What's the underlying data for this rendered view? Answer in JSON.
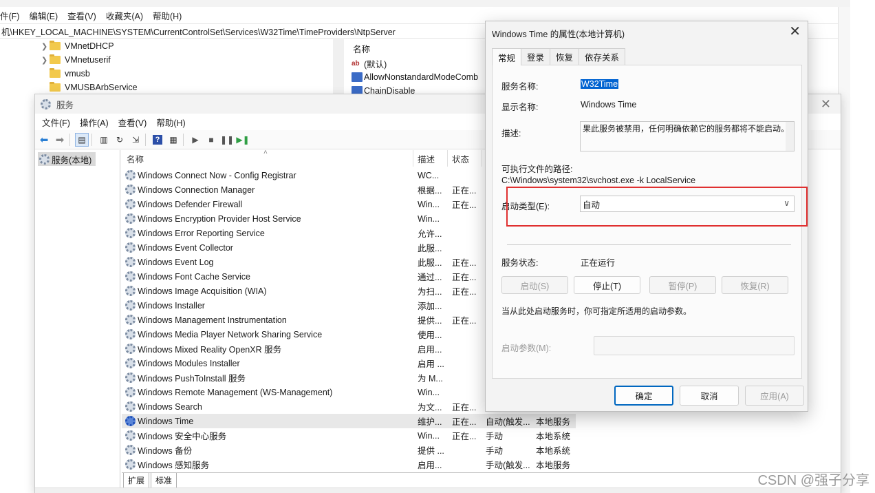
{
  "regedit": {
    "menu": [
      "件(F)",
      "编辑(E)",
      "查看(V)",
      "收藏夹(A)",
      "帮助(H)"
    ],
    "address": "机\\HKEY_LOCAL_MACHINE\\SYSTEM\\CurrentControlSet\\Services\\W32Time\\TimeProviders\\NtpServer",
    "tree": [
      "VMnetDHCP",
      "VMnetuserif",
      "vmusb",
      "VMUSBArbService"
    ],
    "values_header": "名称",
    "values": [
      "(默认)",
      "AllowNonstandardModeComb",
      "ChainDisable"
    ]
  },
  "services": {
    "title": "服务",
    "menu": [
      "文件(F)",
      "操作(A)",
      "查看(V)",
      "帮助(H)"
    ],
    "left_item": "服务(本地)",
    "columns": {
      "name": "名称",
      "desc": "描述",
      "status": "状态"
    },
    "rows": [
      {
        "name": "Windows Connect Now - Config Registrar",
        "desc": "WC...",
        "status": "",
        "start": "",
        "logon": ""
      },
      {
        "name": "Windows Connection Manager",
        "desc": "根据...",
        "status": "正在...",
        "start": "",
        "logon": ""
      },
      {
        "name": "Windows Defender Firewall",
        "desc": "Win...",
        "status": "正在...",
        "start": "",
        "logon": ""
      },
      {
        "name": "Windows Encryption Provider Host Service",
        "desc": "Win...",
        "status": "",
        "start": "",
        "logon": ""
      },
      {
        "name": "Windows Error Reporting Service",
        "desc": "允许...",
        "status": "",
        "start": "",
        "logon": ""
      },
      {
        "name": "Windows Event Collector",
        "desc": "此服...",
        "status": "",
        "start": "",
        "logon": ""
      },
      {
        "name": "Windows Event Log",
        "desc": "此服...",
        "status": "正在...",
        "start": "",
        "logon": ""
      },
      {
        "name": "Windows Font Cache Service",
        "desc": "通过...",
        "status": "正在...",
        "start": "",
        "logon": ""
      },
      {
        "name": "Windows Image Acquisition (WIA)",
        "desc": "为扫...",
        "status": "正在...",
        "start": "",
        "logon": ""
      },
      {
        "name": "Windows Installer",
        "desc": "添加...",
        "status": "",
        "start": "",
        "logon": ""
      },
      {
        "name": "Windows Management Instrumentation",
        "desc": "提供...",
        "status": "正在...",
        "start": "",
        "logon": ""
      },
      {
        "name": "Windows Media Player Network Sharing Service",
        "desc": "使用...",
        "status": "",
        "start": "",
        "logon": ""
      },
      {
        "name": "Windows Mixed Reality OpenXR 服务",
        "desc": "启用...",
        "status": "",
        "start": "",
        "logon": ""
      },
      {
        "name": "Windows Modules Installer",
        "desc": "启用 ...",
        "status": "",
        "start": "",
        "logon": ""
      },
      {
        "name": "Windows PushToInstall 服务",
        "desc": "为 M...",
        "status": "",
        "start": "",
        "logon": ""
      },
      {
        "name": "Windows Remote Management (WS-Management)",
        "desc": "Win...",
        "status": "",
        "start": "",
        "logon": ""
      },
      {
        "name": "Windows Search",
        "desc": "为文...",
        "status": "正在...",
        "start": "",
        "logon": ""
      },
      {
        "name": "Windows Time",
        "desc": "维护...",
        "status": "正在...",
        "start": "自动(触发...",
        "logon": "本地服务"
      },
      {
        "name": "Windows 安全中心服务",
        "desc": "Win...",
        "status": "正在...",
        "start": "手动",
        "logon": "本地系统"
      },
      {
        "name": "Windows 备份",
        "desc": "提供 ...",
        "status": "",
        "start": "手动",
        "logon": "本地系统"
      },
      {
        "name": "Windows 感知服务",
        "desc": "启用...",
        "status": "",
        "start": "手动(触发...",
        "logon": "本地服务"
      }
    ],
    "tabs": [
      "扩展",
      "标准"
    ]
  },
  "dialog": {
    "title": "Windows Time 的属性(本地计算机)",
    "tabs": [
      "常规",
      "登录",
      "恢复",
      "依存关系"
    ],
    "service_name_label": "服务名称:",
    "service_name": "W32Time",
    "display_name_label": "显示名称:",
    "display_name": "Windows Time",
    "desc_label": "描述:",
    "description": "果此服务被禁用，任何明确依赖它的服务都将不能启动。",
    "path_label": "可执行文件的路径:",
    "path": "C:\\Windows\\system32\\svchost.exe -k LocalService",
    "startup_label": "启动类型(E):",
    "startup_value": "自动",
    "status_label": "服务状态:",
    "status_value": "正在运行",
    "buttons": {
      "start": "启动(S)",
      "stop": "停止(T)",
      "pause": "暂停(P)",
      "resume": "恢复(R)"
    },
    "hint": "当从此处启动服务时，你可指定所适用的启动参数。",
    "param_label": "启动参数(M):",
    "footer": {
      "ok": "确定",
      "cancel": "取消",
      "apply": "应用(A)"
    }
  },
  "watermark": "CSDN @强子分享"
}
